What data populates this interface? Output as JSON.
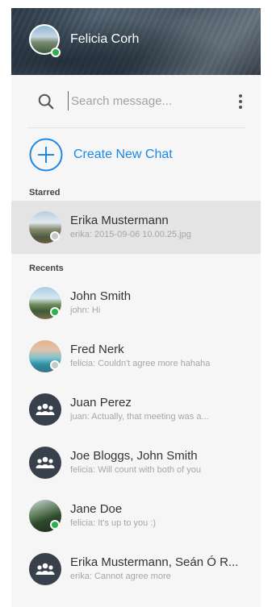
{
  "header": {
    "user_name": "Felicia Corh",
    "status": "online"
  },
  "search": {
    "placeholder": "Search message..."
  },
  "create_chat": {
    "label": "Create New Chat"
  },
  "sections": {
    "starred": "Starred",
    "recents": "Recents"
  },
  "starred": [
    {
      "name": "Erika Mustermann",
      "preview": "erika: 2015-09-06 10.00.25.jpg",
      "status": "offline",
      "avatar": "av-mountain"
    }
  ],
  "recents": [
    {
      "name": "John Smith",
      "preview": "john:  Hi",
      "status": "online",
      "avatar": "av-lake"
    },
    {
      "name": "Fred Nerk",
      "preview": "felicia: Couldn't agree more hahaha",
      "status": "offline",
      "avatar": "av-beach"
    },
    {
      "name": "Juan Perez",
      "preview": "juan: Actually, that meeting was a...",
      "status": "group",
      "avatar": "group-icon"
    },
    {
      "name": "Joe Bloggs, John Smith",
      "preview": "felicia: Will count with both of you",
      "status": "group",
      "avatar": "group-icon"
    },
    {
      "name": "Jane Doe",
      "preview": "felicia: It's up to you :)",
      "status": "online",
      "avatar": "av-forest"
    },
    {
      "name": "Erika Mustermann, Seán Ó R...",
      "preview": "erika: Cannot agree more",
      "status": "group",
      "avatar": "group-icon"
    }
  ],
  "colors": {
    "online": "#2bb24c",
    "offline": "#c8c8c8",
    "accent": "#1e88e5"
  }
}
